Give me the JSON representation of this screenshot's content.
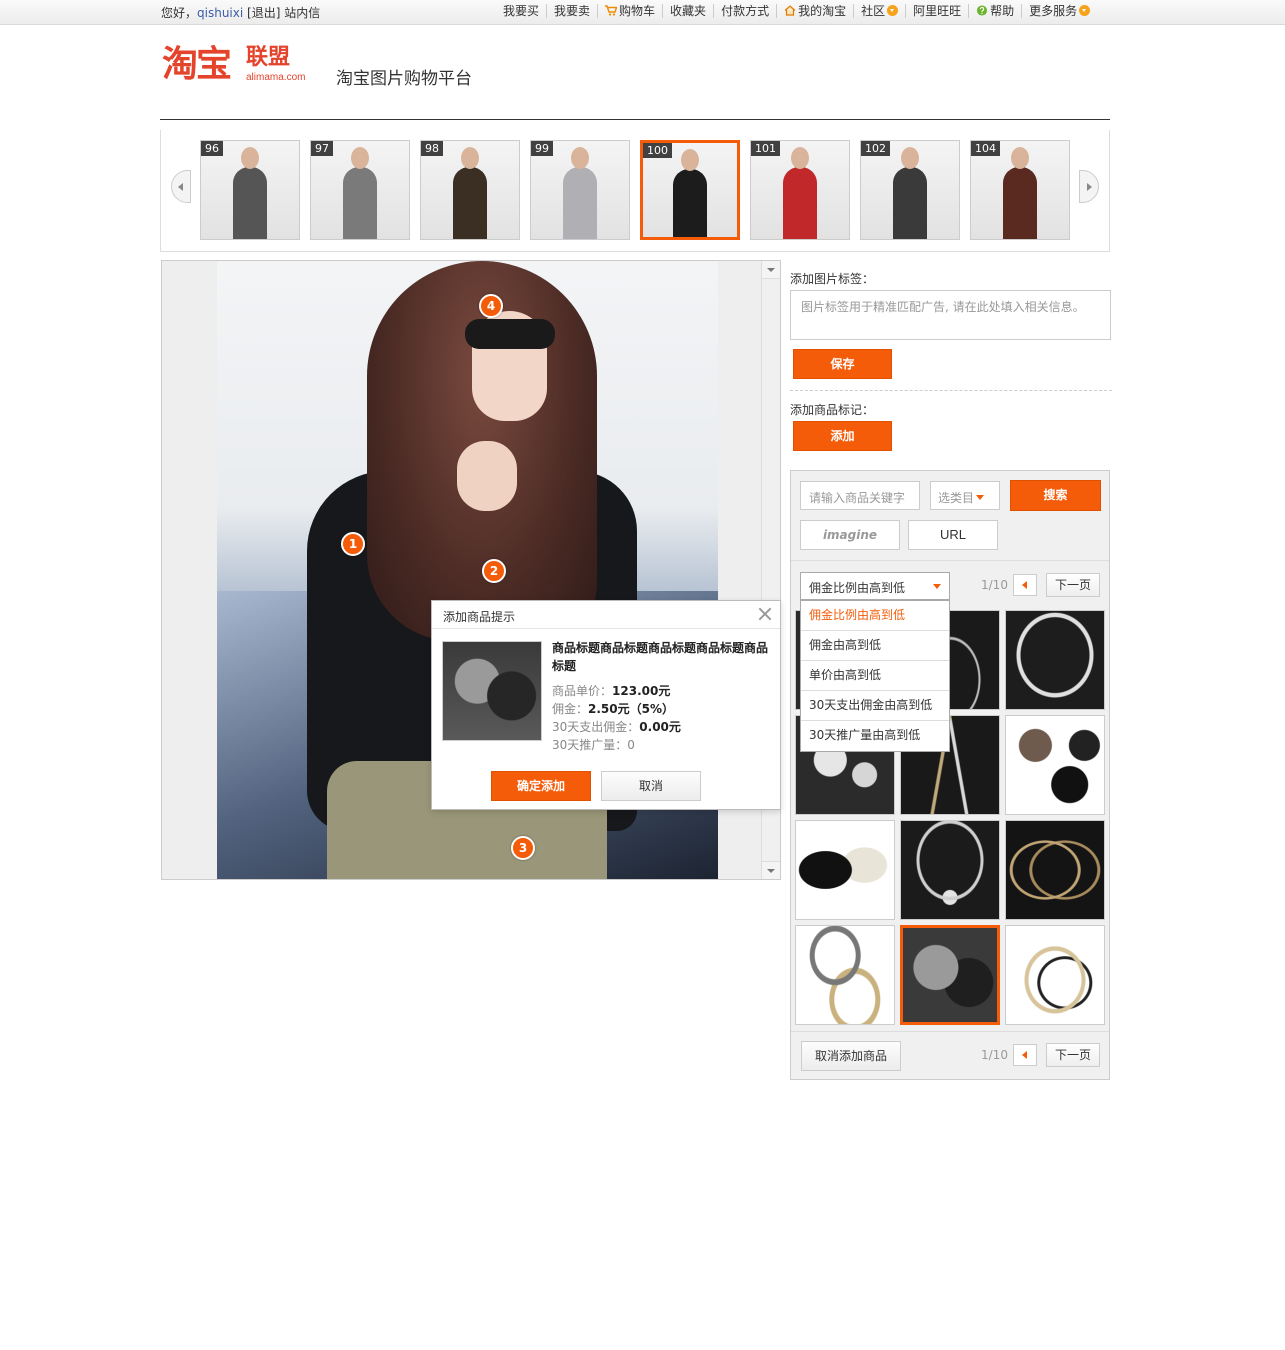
{
  "topbar": {
    "greeting": "您好，",
    "username": "qishuixi",
    "logout": "[退出]",
    "messages": "站内信",
    "nav": [
      {
        "label": "我要买",
        "icon": ""
      },
      {
        "label": "我要卖",
        "icon": ""
      },
      {
        "label": "购物车",
        "icon": "cart-icon"
      },
      {
        "label": "收藏夹",
        "icon": ""
      },
      {
        "label": "付款方式",
        "icon": ""
      },
      {
        "label": "我的淘宝",
        "icon": "home-icon"
      },
      {
        "label": "社区",
        "icon": "dropdown-icon"
      },
      {
        "label": "阿里旺旺",
        "icon": ""
      },
      {
        "label": "帮助",
        "icon": "help-icon"
      },
      {
        "label": "更多服务",
        "icon": "dropdown-icon"
      }
    ]
  },
  "header": {
    "logo_main": "淘宝",
    "logo_sub": "联盟",
    "logo_en": "alimama.com",
    "title": "淘宝图片购物平台"
  },
  "carousel": {
    "items": [
      {
        "num": "96",
        "color": "#555555"
      },
      {
        "num": "97",
        "color": "#7a7a7a"
      },
      {
        "num": "98",
        "color": "#3b2f24"
      },
      {
        "num": "99",
        "color": "#b0b0b4"
      },
      {
        "num": "100",
        "color": "#1c1c1c",
        "active": true
      },
      {
        "num": "101",
        "color": "#c0282a"
      },
      {
        "num": "102",
        "color": "#3a3a3a"
      },
      {
        "num": "104",
        "color": "#5a2a20"
      }
    ]
  },
  "markers": [
    "1",
    "2",
    "3",
    "4"
  ],
  "dialog": {
    "title": "添加商品提示",
    "product_title": "商品标题商品标题商品标题商品标题商品标题",
    "price_label": "商品单价：",
    "price_value": "123.00元",
    "commission_label": "佣金：",
    "commission_value": "2.50元（5%）",
    "commission30_label": "30天支出佣金：",
    "commission30_value": "0.00元",
    "promo_label": "30天推广量：",
    "promo_value": "0",
    "confirm": "确定添加",
    "cancel": "取消"
  },
  "tags": {
    "label": "添加图片标签：",
    "placeholder": "图片标签用于精准匹配广告, 请在此处填入相关信息。",
    "save": "保存"
  },
  "marks": {
    "label": "添加商品标记：",
    "add": "添加"
  },
  "search": {
    "keyword_placeholder": "请输入商品关键字",
    "category": "选类目",
    "search_btn": "搜索",
    "tab_imagine": "imagine",
    "tab_url": "URL",
    "sort_selected": "佣金比例由高到低",
    "sort_options": [
      "佣金比例由高到低",
      "佣金由高到低",
      "单价由高到低",
      "30天支出佣金由高到低",
      "30天推广量由高到低"
    ],
    "page": "1/10",
    "next": "下一页",
    "cancel_add": "取消添加商品"
  },
  "colors": {
    "accent": "#f45c0a",
    "brand": "#e4432c",
    "link": "#3b5ca8"
  }
}
